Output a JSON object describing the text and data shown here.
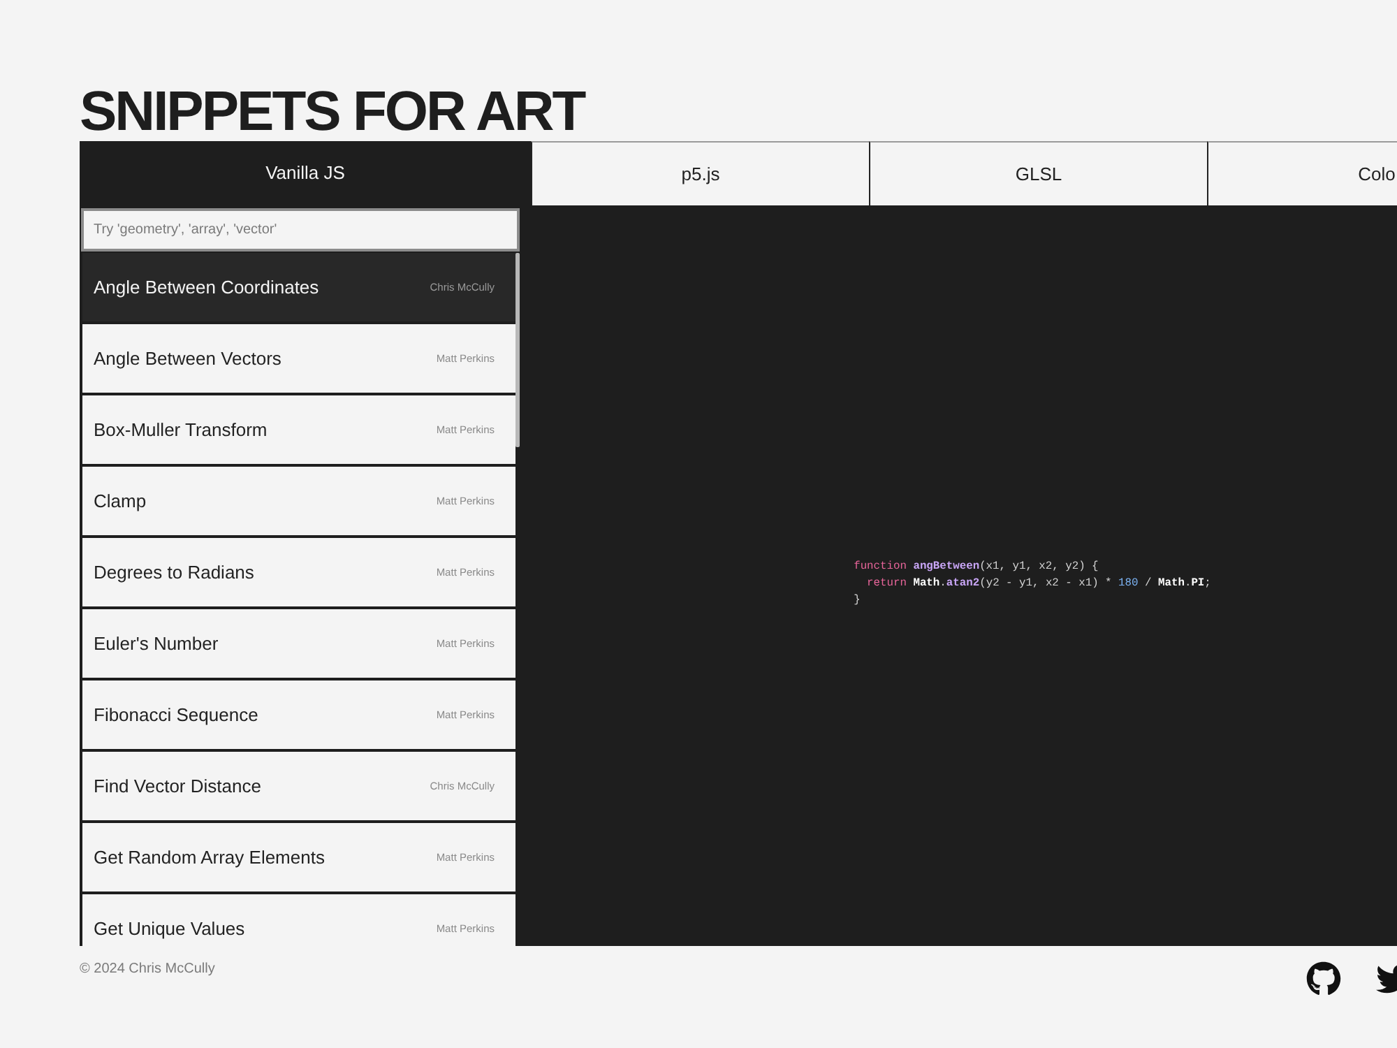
{
  "title": "SNIPPETS FOR ART",
  "tabs": [
    {
      "label": "Vanilla JS",
      "selected": true
    },
    {
      "label": "p5.js",
      "selected": false
    },
    {
      "label": "GLSL",
      "selected": false
    },
    {
      "label": "Colo",
      "selected": false
    }
  ],
  "search": {
    "placeholder": "Try 'geometry', 'array', 'vector'"
  },
  "snippets": [
    {
      "title": "Angle Between Coordinates",
      "author": "Chris McCully",
      "selected": true
    },
    {
      "title": "Angle Between Vectors",
      "author": "Matt Perkins",
      "selected": false
    },
    {
      "title": "Box-Muller Transform",
      "author": "Matt Perkins",
      "selected": false
    },
    {
      "title": "Clamp",
      "author": "Matt Perkins",
      "selected": false
    },
    {
      "title": "Degrees to Radians",
      "author": "Matt Perkins",
      "selected": false
    },
    {
      "title": "Euler's Number",
      "author": "Matt Perkins",
      "selected": false
    },
    {
      "title": "Fibonacci Sequence",
      "author": "Matt Perkins",
      "selected": false
    },
    {
      "title": "Find Vector Distance",
      "author": "Chris McCully",
      "selected": false
    },
    {
      "title": "Get Random Array Elements",
      "author": "Matt Perkins",
      "selected": false
    },
    {
      "title": "Get Unique Values",
      "author": "Matt Perkins",
      "selected": false
    }
  ],
  "code": {
    "lines": [
      [
        {
          "kind": "keyword",
          "text": "function "
        },
        {
          "kind": "function",
          "text": "angBetween"
        },
        {
          "kind": "plain",
          "text": "(x1, y1, x2, y2) {"
        }
      ],
      [
        {
          "kind": "keyword",
          "text": "  return "
        },
        {
          "kind": "builtin",
          "text": "Math"
        },
        {
          "kind": "plain",
          "text": "."
        },
        {
          "kind": "function",
          "text": "atan2"
        },
        {
          "kind": "plain",
          "text": "(y2 - y1, x2 - x1) * "
        },
        {
          "kind": "number",
          "text": "180"
        },
        {
          "kind": "plain",
          "text": " / "
        },
        {
          "kind": "builtin",
          "text": "Math"
        },
        {
          "kind": "plain",
          "text": "."
        },
        {
          "kind": "builtin",
          "text": "PI"
        },
        {
          "kind": "plain",
          "text": ";"
        }
      ],
      [
        {
          "kind": "plain",
          "text": "}"
        }
      ]
    ]
  },
  "footer": {
    "copyright": "© 2024 Chris McCully"
  }
}
